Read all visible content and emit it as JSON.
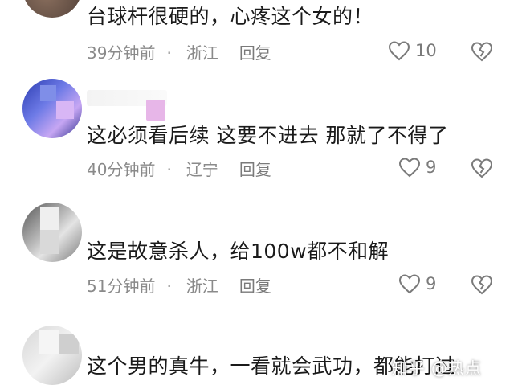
{
  "comments": [
    {
      "text": "台球杆很硬的，心疼这个女的！",
      "time": "39分钟前",
      "location": "浙江",
      "reply_label": "回复",
      "likes": "10"
    },
    {
      "text": "这必须看后续  这要不进去  那就了不得了",
      "time": "40分钟前",
      "location": "辽宁",
      "reply_label": "回复",
      "likes": "9"
    },
    {
      "text": "这是故意杀人，给100w都不和解",
      "time": "51分钟前",
      "location": "浙江",
      "reply_label": "回复",
      "likes": "9"
    },
    {
      "text": "这个男的真牛，一看就会武功，都能打过",
      "time": "",
      "location": "",
      "reply_label": "",
      "likes": ""
    }
  ],
  "separator": "·",
  "watermark": "知乎 @热点",
  "icons": {
    "like": "heart-outline-icon",
    "dislike": "broken-heart-icon"
  },
  "colors": {
    "text": "#1a1a1a",
    "meta": "#8a8a8a",
    "icon": "#7a7a7a"
  }
}
